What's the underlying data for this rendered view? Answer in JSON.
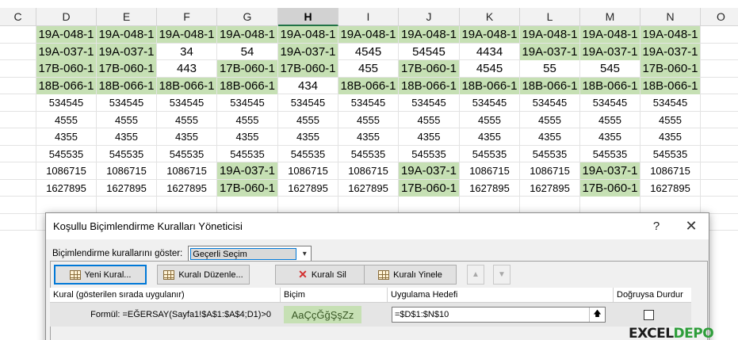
{
  "columns": [
    "C",
    "D",
    "E",
    "F",
    "G",
    "H",
    "I",
    "J",
    "K",
    "L",
    "M",
    "N",
    "O"
  ],
  "selected_column": "H",
  "rows": [
    [
      "",
      "19A-048-1",
      "19A-048-1",
      "19A-048-1",
      "19A-048-1",
      "19A-048-1",
      "19A-048-1",
      "19A-048-1",
      "19A-048-1",
      "19A-048-1",
      "19A-048-1",
      "19A-048-1",
      ""
    ],
    [
      "",
      "19A-037-1",
      "19A-037-1",
      "34",
      "54",
      "19A-037-1",
      "4545",
      "54545",
      "4434",
      "19A-037-1",
      "19A-037-1",
      "19A-037-1",
      ""
    ],
    [
      "",
      "17B-060-1",
      "17B-060-1",
      "443",
      "17B-060-1",
      "17B-060-1",
      "455",
      "17B-060-1",
      "4545",
      "55",
      "545",
      "17B-060-1",
      ""
    ],
    [
      "",
      "18B-066-1",
      "18B-066-1",
      "18B-066-1",
      "18B-066-1",
      "434",
      "18B-066-1",
      "18B-066-1",
      "18B-066-1",
      "18B-066-1",
      "18B-066-1",
      "18B-066-1",
      ""
    ],
    [
      "",
      "534545",
      "534545",
      "534545",
      "534545",
      "534545",
      "534545",
      "534545",
      "534545",
      "534545",
      "534545",
      "534545",
      ""
    ],
    [
      "",
      "4555",
      "4555",
      "4555",
      "4555",
      "4555",
      "4555",
      "4555",
      "4555",
      "4555",
      "4555",
      "4555",
      ""
    ],
    [
      "",
      "4355",
      "4355",
      "4355",
      "4355",
      "4355",
      "4355",
      "4355",
      "4355",
      "4355",
      "4355",
      "4355",
      ""
    ],
    [
      "",
      "545535",
      "545535",
      "545535",
      "545535",
      "545535",
      "545535",
      "545535",
      "545535",
      "545535",
      "545535",
      "545535",
      ""
    ],
    [
      "",
      "1086715",
      "1086715",
      "1086715",
      "19A-037-1",
      "1086715",
      "1086715",
      "19A-037-1",
      "1086715",
      "1086715",
      "19A-037-1",
      "1086715",
      ""
    ],
    [
      "",
      "1627895",
      "1627895",
      "1627895",
      "17B-060-1",
      "1627895",
      "1627895",
      "17B-060-1",
      "1627895",
      "1627895",
      "17B-060-1",
      "1627895",
      ""
    ],
    [
      "",
      "",
      "",
      "",
      "",
      "",
      "",
      "",
      "",
      "",
      "",
      "",
      ""
    ],
    [
      "",
      "",
      "",
      "",
      "",
      "",
      "",
      "",
      "",
      "",
      "",
      "",
      ""
    ]
  ],
  "highlight_color": "#c6e0b4",
  "dialog": {
    "title": "Koşullu Biçimlendirme Kuralları Yöneticisi",
    "help_label": "?",
    "close_label": "✕",
    "show_label": "Biçimlendirme kurallarını göster:",
    "show_value": "Geçerli Seçim",
    "buttons": {
      "new_rule": "Yeni Kural...",
      "edit_rule": "Kuralı Düzenle...",
      "delete_rule": "Kuralı Sil",
      "duplicate_rule": "Kuralı Yinele"
    },
    "headers": {
      "rule": "Kural (gösterilen sırada uygulanır)",
      "format": "Biçim",
      "applies_to": "Uygulama Hedefi",
      "stop_if_true": "Doğruysa Durdur"
    },
    "rule": {
      "formula": "Formül: =EĞERSAY(Sayfa1!$A$1:$A$4;D1)>0",
      "preview": "AaÇçĞğŞşZz",
      "applies_to": "=$D$1:$N$10",
      "stop_if_true": false
    }
  },
  "watermark": {
    "part1": "EXCEL",
    "part2": "DEPO"
  }
}
